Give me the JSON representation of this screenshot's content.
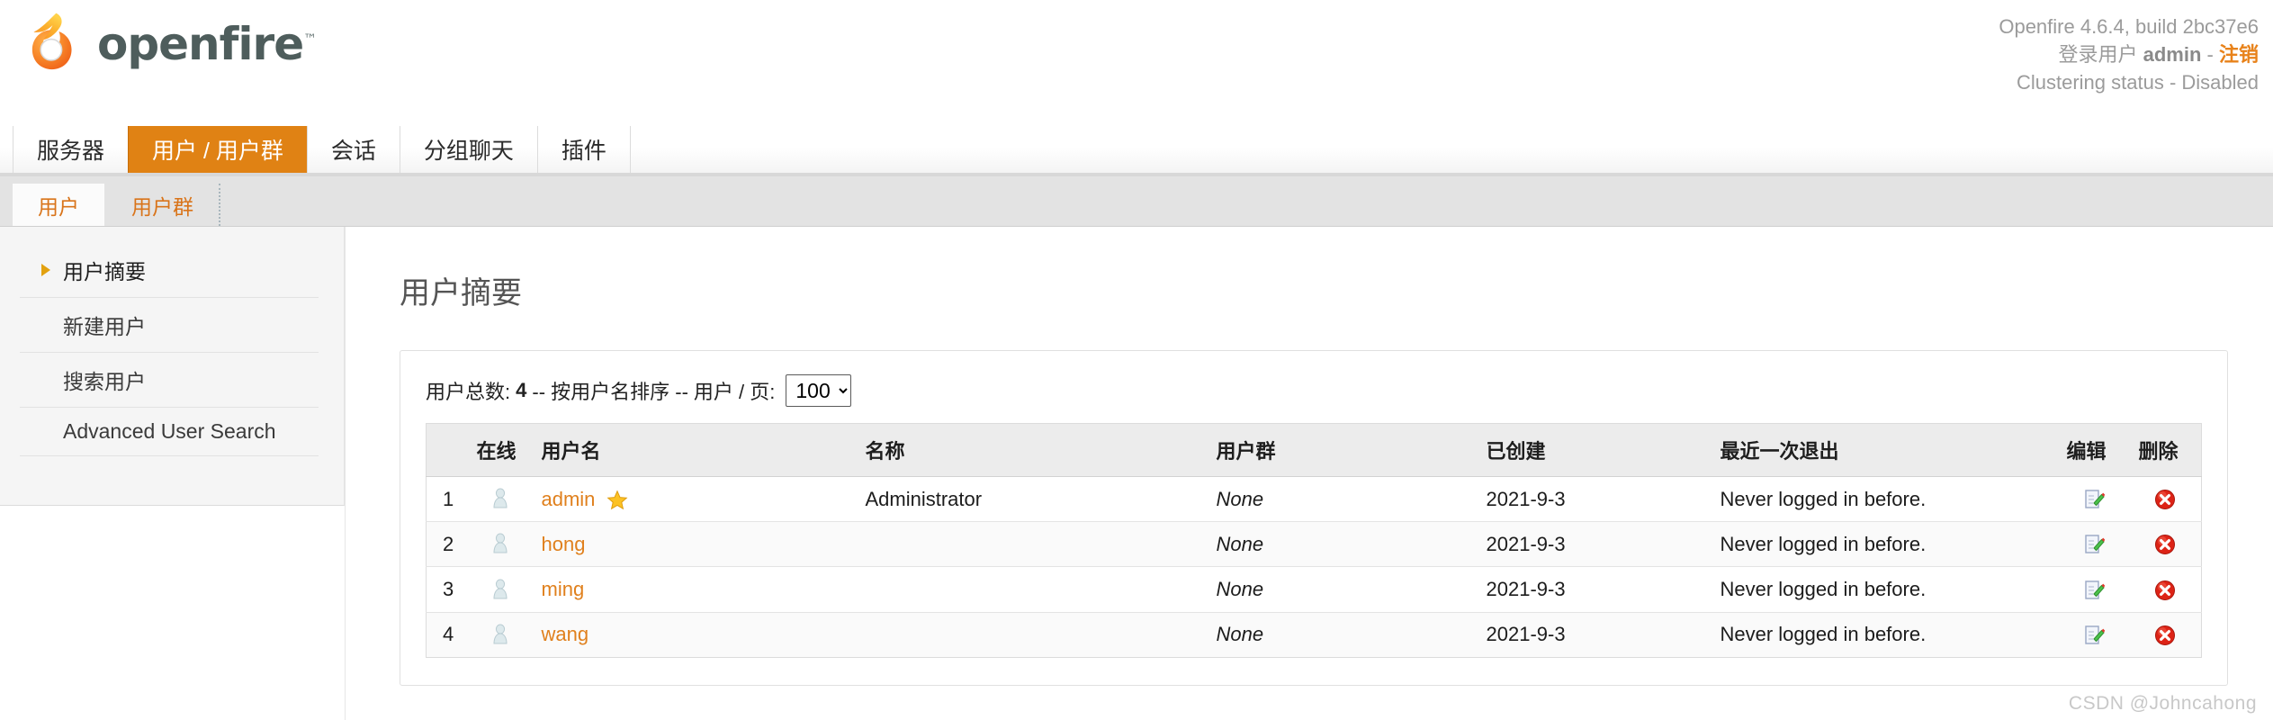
{
  "brand": {
    "name": "openfire",
    "tm": "™",
    "logo_icon": "openfire-flame-logo",
    "text_color": "#4e5d5c",
    "accent_color": "#e08214"
  },
  "header": {
    "version_line": "Openfire 4.6.4, build 2bc37e6",
    "login_prefix": "登录用户",
    "login_user": "admin",
    "login_sep": "-",
    "logout_label": "注销",
    "clustering_line": "Clustering status - Disabled"
  },
  "main_tabs": [
    {
      "label": "服务器",
      "active": false
    },
    {
      "label": "用户 / 用户群",
      "active": true
    },
    {
      "label": "会话",
      "active": false
    },
    {
      "label": "分组聊天",
      "active": false
    },
    {
      "label": "插件",
      "active": false
    }
  ],
  "sub_tabs": [
    {
      "label": "用户",
      "active": true
    },
    {
      "label": "用户群",
      "active": false
    }
  ],
  "sidebar": {
    "items": [
      {
        "label": "用户摘要",
        "active": true
      },
      {
        "label": "新建用户",
        "active": false
      },
      {
        "label": "搜索用户",
        "active": false
      },
      {
        "label": "Advanced User Search",
        "active": false
      }
    ]
  },
  "main": {
    "page_title": "用户摘要",
    "summary": {
      "total_label": "用户总数:",
      "total_value": "4",
      "sort_note": "-- 按用户名排序 --",
      "per_page_label": "用户 / 页:",
      "per_page_value": "100",
      "per_page_options": [
        "100"
      ]
    },
    "table": {
      "columns": [
        "",
        "在线",
        "用户名",
        "名称",
        "用户群",
        "已创建",
        "最近一次退出",
        "编辑",
        "删除"
      ],
      "rows": [
        {
          "index": "1",
          "status_icon": "user-offline-icon",
          "username": "admin",
          "is_admin": true,
          "admin_badge_icon": "gold-star-icon",
          "name": "Administrator",
          "group": "None",
          "created": "2021-9-3",
          "last_logout": "Never logged in before.",
          "edit_icon": "edit-note-icon",
          "delete_icon": "delete-red-x-icon"
        },
        {
          "index": "2",
          "status_icon": "user-offline-icon",
          "username": "hong",
          "is_admin": false,
          "admin_badge_icon": "",
          "name": "",
          "group": "None",
          "created": "2021-9-3",
          "last_logout": "Never logged in before.",
          "edit_icon": "edit-note-icon",
          "delete_icon": "delete-red-x-icon"
        },
        {
          "index": "3",
          "status_icon": "user-offline-icon",
          "username": "ming",
          "is_admin": false,
          "admin_badge_icon": "",
          "name": "",
          "group": "None",
          "created": "2021-9-3",
          "last_logout": "Never logged in before.",
          "edit_icon": "edit-note-icon",
          "delete_icon": "delete-red-x-icon"
        },
        {
          "index": "4",
          "status_icon": "user-offline-icon",
          "username": "wang",
          "is_admin": false,
          "admin_badge_icon": "",
          "name": "",
          "group": "None",
          "created": "2021-9-3",
          "last_logout": "Never logged in before.",
          "edit_icon": "edit-note-icon",
          "delete_icon": "delete-red-x-icon"
        }
      ]
    }
  },
  "watermark": "CSDN @Johncahong"
}
